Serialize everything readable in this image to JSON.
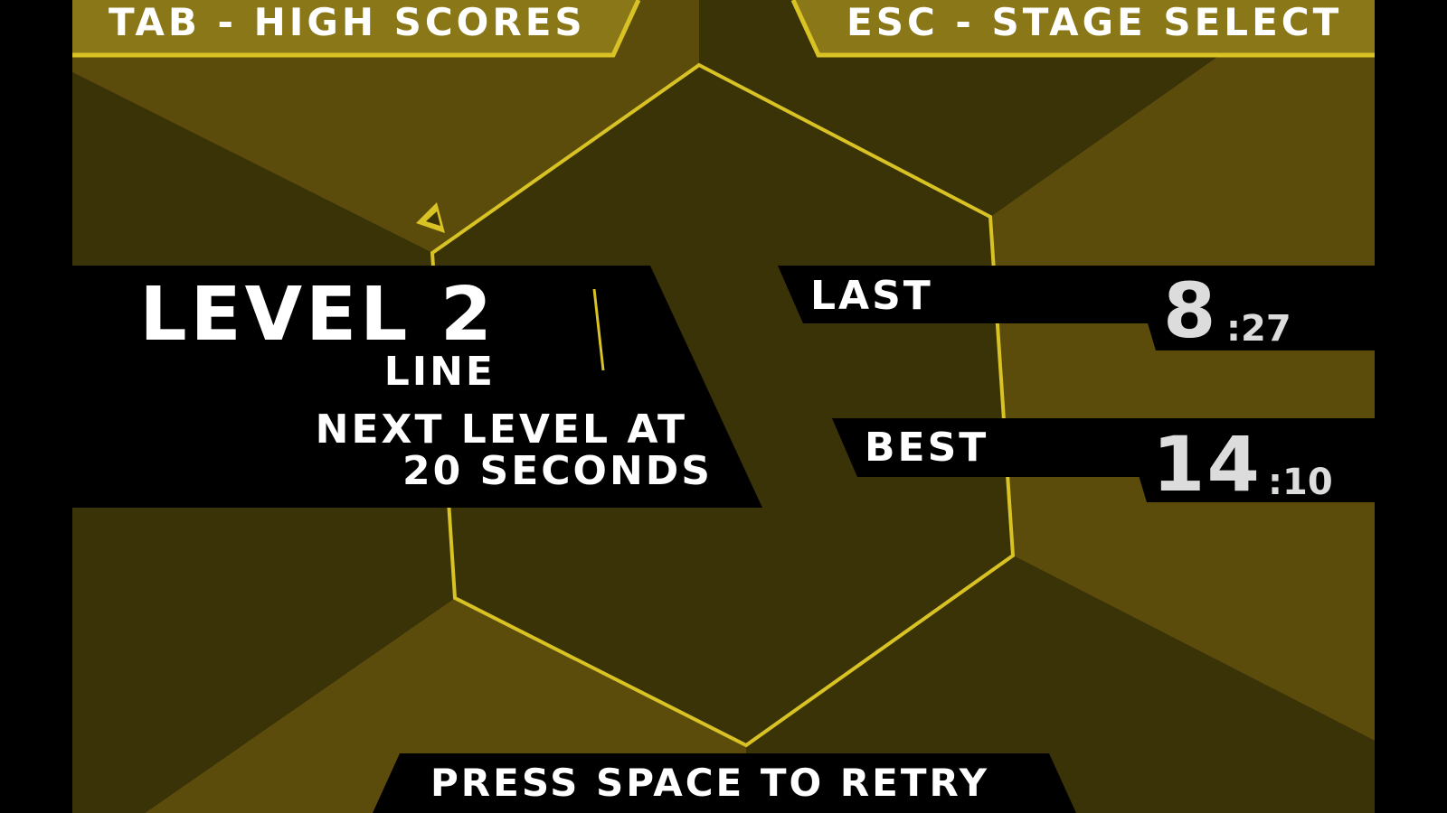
{
  "colors": {
    "background": "#000000",
    "wedge_dark": "#3b3308",
    "wedge_light": "#5b4c0c",
    "center_fill": "#3b3308",
    "accent": "#d8c224",
    "top_bar_fill": "#8a7818",
    "panel": "#000000",
    "text": "#ffffff",
    "time_text": "#dcdcdc"
  },
  "controls": {
    "high_scores": "TAB - HIGH SCORES",
    "stage_select": "ESC - STAGE SELECT",
    "retry": "PRESS SPACE TO RETRY"
  },
  "level": {
    "title": "LEVEL 2",
    "subtitle": "LINE",
    "next_line1": "NEXT LEVEL AT",
    "next_line2": "20 SECONDS"
  },
  "scores": {
    "last": {
      "label": "LAST",
      "seconds": "8",
      "fraction": ":27"
    },
    "best": {
      "label": "BEST",
      "seconds": "14",
      "fraction": ":10"
    }
  },
  "icons": {
    "player": "player-triangle-icon"
  }
}
